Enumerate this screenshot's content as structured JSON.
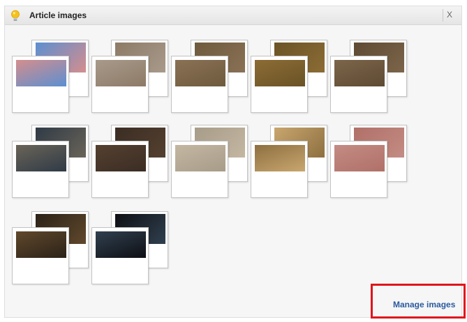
{
  "panel": {
    "title": "Article images",
    "close_label": "X",
    "manage_label": "Manage images"
  },
  "icons": {
    "header": "lightbulb-icon",
    "close": "close-icon"
  },
  "colors": {
    "highlight": "#e0151c",
    "link": "#2a5a9e"
  },
  "images": [
    {
      "row": 1,
      "col": 1,
      "scenes": [
        "pink palazzo facade on canal",
        "pink palazzo facade"
      ]
    },
    {
      "row": 1,
      "col": 2,
      "scenes": [
        "ornate stucco ceiling",
        "stucco sculpture detail"
      ]
    },
    {
      "row": 1,
      "col": 3,
      "scenes": [
        "hotel bedroom",
        "hotel bedroom with beds"
      ]
    },
    {
      "row": 1,
      "col": 4,
      "scenes": [
        "gilded ceiling with chandelier",
        "ballroom ceiling"
      ]
    },
    {
      "row": 1,
      "col": 5,
      "scenes": [
        "guest room",
        "guest room with lamp"
      ]
    },
    {
      "row": 2,
      "col": 1,
      "scenes": [
        "arched windows",
        "marble staircase"
      ]
    },
    {
      "row": 2,
      "col": 2,
      "scenes": [
        "hall with chandelier",
        "hall with chandelier"
      ]
    },
    {
      "row": 2,
      "col": 3,
      "scenes": [
        "painted ceiling",
        "fresco ceiling"
      ]
    },
    {
      "row": 2,
      "col": 4,
      "scenes": [
        "arched courtyard",
        "illuminated arches"
      ]
    },
    {
      "row": 2,
      "col": 5,
      "scenes": [
        "stucco wall relief",
        "stucco wall relief"
      ]
    },
    {
      "row": 3,
      "col": 1,
      "scenes": [
        "candlelit dining room",
        "candlelit dining room"
      ]
    },
    {
      "row": 3,
      "col": 2,
      "scenes": [
        "dark gothic windows",
        "gothic windows"
      ]
    }
  ]
}
